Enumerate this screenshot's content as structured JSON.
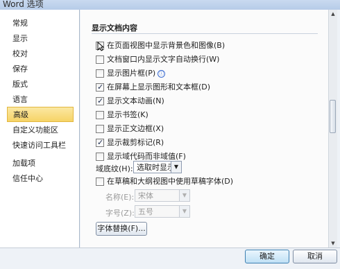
{
  "window": {
    "title": "Word 选项"
  },
  "sidebar": {
    "items": [
      {
        "label": "常规"
      },
      {
        "label": "显示"
      },
      {
        "label": "校对"
      },
      {
        "label": "保存"
      },
      {
        "label": "版式"
      },
      {
        "label": "语言"
      },
      {
        "label": "高级",
        "active": true
      },
      {
        "label": "自定义功能区"
      },
      {
        "label": "快速访问工具栏"
      },
      {
        "label": "加载项"
      },
      {
        "label": "信任中心"
      }
    ]
  },
  "main": {
    "section_title": "显示文档内容",
    "options": [
      {
        "label": "在页面视图中显示背景色和图像(B)",
        "checked": false
      },
      {
        "label": "文档窗口内显示文字自动换行(W)",
        "checked": false
      },
      {
        "label": "显示图片框(P)",
        "checked": false,
        "info_icon": "ⓘ"
      },
      {
        "label": "在屏幕上显示图形和文本框(D)",
        "checked": true
      },
      {
        "label": "显示文本动画(N)",
        "checked": true
      },
      {
        "label": "显示书签(K)",
        "checked": false
      },
      {
        "label": "显示正文边框(X)",
        "checked": false
      },
      {
        "label": "显示裁剪标记(R)",
        "checked": true
      },
      {
        "label": "显示域代码而非域值(F)",
        "checked": false
      }
    ],
    "shading": {
      "label": "域底纹(H):",
      "value": "选取时显示"
    },
    "draft_font": {
      "label": "在草稿和大纲视图中使用草稿字体(D)",
      "checked": false
    },
    "font_name": {
      "label": "名称(E):",
      "value": "宋体"
    },
    "font_size": {
      "label": "字号(Z):",
      "value": "五号"
    },
    "font_substitution_button": "字体替换(F)..."
  },
  "footer": {
    "ok_label": "确定",
    "cancel_label": "取消"
  },
  "icons": {
    "dropdown": "chevron-down-icon",
    "scroll_up": "scroll-up-icon",
    "scroll_down": "scroll-down-icon",
    "info": "info-icon"
  }
}
